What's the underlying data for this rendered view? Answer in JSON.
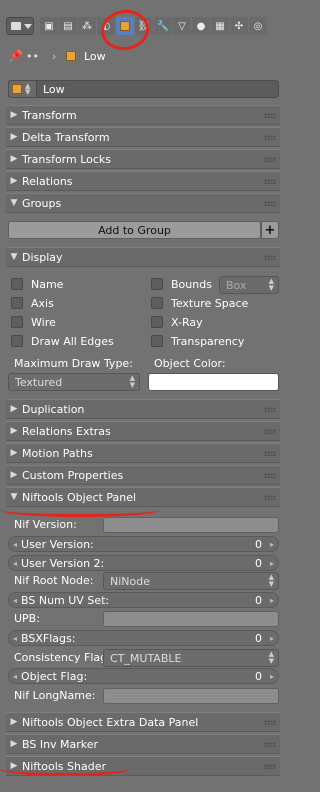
{
  "toolbar": {
    "context_tabs": [
      "render",
      "render-layers",
      "scene",
      "world",
      "object",
      "constraints",
      "modifiers",
      "data",
      "material",
      "texture",
      "particles",
      "physics"
    ],
    "active_tab": "object"
  },
  "breadcrumb": {
    "pin": "📌",
    "scene_icon": "••",
    "sep": "›",
    "object": "Low"
  },
  "object_name": "Low",
  "panels": {
    "transform": "Transform",
    "delta_transform": "Delta Transform",
    "transform_locks": "Transform Locks",
    "relations": "Relations",
    "groups": "Groups",
    "add_to_group": "Add to Group",
    "plus": "+",
    "display": "Display",
    "duplication": "Duplication",
    "relations_extras": "Relations Extras",
    "motion_paths": "Motion Paths",
    "custom_properties": "Custom Properties",
    "niftools_object_panel": "Niftools Object Panel",
    "niftools_extra": "Niftools Object Extra Data Panel",
    "bs_inv_marker": "BS Inv Marker",
    "niftools_shader": "Niftools Shader"
  },
  "display": {
    "name": "Name",
    "axis": "Axis",
    "wire": "Wire",
    "draw_all_edges": "Draw All Edges",
    "bounds": "Bounds",
    "bounds_type": "Box",
    "texture_space": "Texture Space",
    "xray": "X-Ray",
    "transparency": "Transparency",
    "max_draw_type_label": "Maximum Draw Type:",
    "max_draw_type": "Textured",
    "object_color_label": "Object Color:",
    "object_color": "#ffffff"
  },
  "nif": {
    "nif_version": "Nif Version:",
    "user_version": "User Version:",
    "user_version_val": "0",
    "user_version2": "User Version 2:",
    "user_version2_val": "0",
    "root_node_label": "Nif Root Node:",
    "root_node": "NiNode",
    "bs_num_uv": "BS Num UV Set:",
    "bs_num_uv_val": "0",
    "upb": "UPB:",
    "bsx_flags": "BSXFlags:",
    "bsx_flags_val": "0",
    "consistency_label": "Consistency Flag:",
    "consistency": "CT_MUTABLE",
    "object_flag": "Object Flag:",
    "object_flag_val": "0",
    "longname": "Nif LongName:"
  },
  "colors": {
    "accent": "#5680c2",
    "annotation": "#e3251b"
  }
}
